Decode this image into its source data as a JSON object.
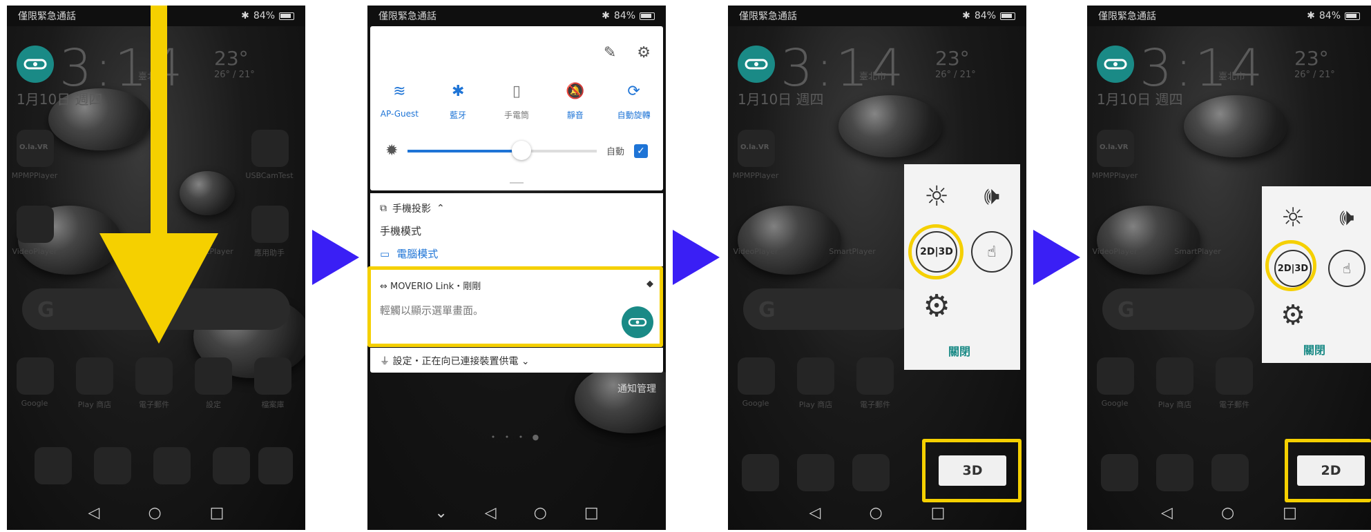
{
  "status": {
    "carrier": "僅限緊急通話",
    "battery": "84%"
  },
  "home": {
    "clock": "3:14",
    "city": "臺北市",
    "date": "1月10日 週四",
    "temp": "23°",
    "temp_range": "26° / 21°",
    "apps_row1": [
      "MPMPPlayer",
      "USBCamTest"
    ],
    "apps_row2": [
      "VideoPlayer",
      "SmartPlayer",
      "應用助手"
    ],
    "dock_labels": [
      "Google",
      "Play 商店",
      "電子郵件",
      "設定",
      "檔案庫"
    ],
    "brand_tile": "O.la.VR"
  },
  "quick_settings": {
    "toggles": [
      {
        "label": "AP-Guest",
        "icon": "wifi-icon",
        "active": true
      },
      {
        "label": "藍牙",
        "icon": "bluetooth-icon",
        "active": true
      },
      {
        "label": "手電筒",
        "icon": "flashlight-icon",
        "active": false
      },
      {
        "label": "靜音",
        "icon": "mute-icon",
        "active": true
      },
      {
        "label": "自動旋轉",
        "icon": "rotate-icon",
        "active": true
      }
    ],
    "brightness_auto": "自動",
    "brightness_level": 0.6
  },
  "notifications": {
    "projection_header": "手機投影",
    "phone_mode": "手機模式",
    "pc_mode": "電腦模式",
    "moverio_title": "MOVERIO Link・剛剛",
    "moverio_body": "輕觸以顯示選單畫面。",
    "usb_text": "設定・正在向已連接裝置供電",
    "manage": "通知管理"
  },
  "menu": {
    "close": "關閉",
    "toggle_2d3d": "2D|3D"
  },
  "mode_button_3": "3D",
  "mode_button_4": "2D",
  "colors": {
    "highlight": "#f5d000",
    "arrow": "#3a1ff5",
    "accent": "#1e74d6",
    "teal": "#1a8a86"
  }
}
